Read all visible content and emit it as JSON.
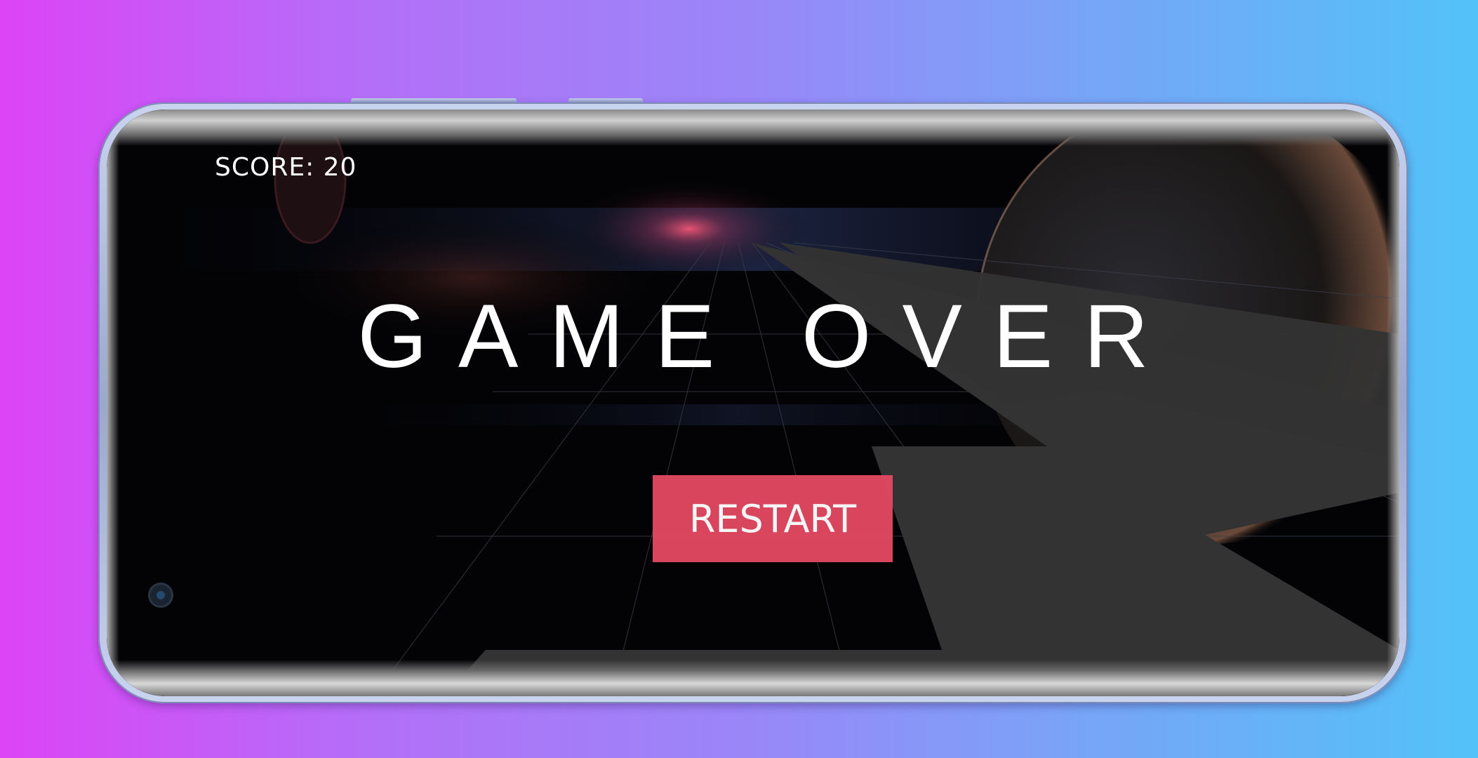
{
  "game": {
    "score_text": "SCORE: 20",
    "title": "GAME OVER",
    "restart_label": "RESTART"
  },
  "colors": {
    "restart_button": "#e14860",
    "background_left": "#dc44f6",
    "background_right": "#52c2f8"
  },
  "icons": {
    "camera": "front-camera-icon"
  }
}
